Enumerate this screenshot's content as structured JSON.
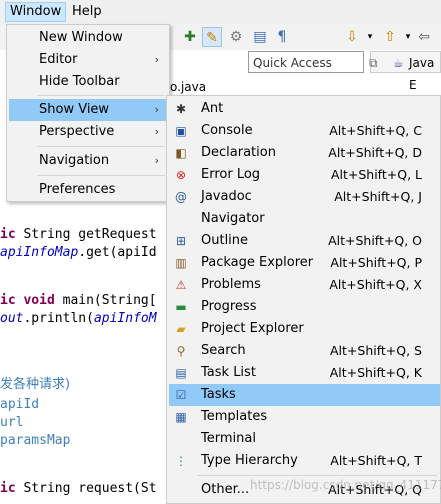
{
  "menubar": {
    "window": "Window",
    "help": "Help"
  },
  "quick_access": {
    "placeholder": "Quick Access",
    "perspective": "Java E"
  },
  "editor_tab": "o.java",
  "window_menu": {
    "items": [
      {
        "label": "New Window"
      },
      {
        "label": "Editor",
        "arrow": "›"
      },
      {
        "label": "Hide Toolbar"
      },
      {
        "label": "Show View",
        "arrow": "›"
      },
      {
        "label": "Perspective",
        "arrow": "›"
      },
      {
        "label": "Navigation",
        "arrow": "›"
      },
      {
        "label": "Preferences"
      }
    ]
  },
  "show_view": {
    "items": [
      {
        "label": "Ant",
        "shortcut": "",
        "icon": "ant-icon"
      },
      {
        "label": "Console",
        "shortcut": "Alt+Shift+Q, C",
        "icon": "console-icon"
      },
      {
        "label": "Declaration",
        "shortcut": "Alt+Shift+Q, D",
        "icon": "declaration-icon"
      },
      {
        "label": "Error Log",
        "shortcut": "Alt+Shift+Q, L",
        "icon": "error-log-icon"
      },
      {
        "label": "Javadoc",
        "shortcut": "Alt+Shift+Q, J",
        "icon": "javadoc-icon"
      },
      {
        "label": "Navigator",
        "shortcut": "",
        "icon": "navigator-icon"
      },
      {
        "label": "Outline",
        "shortcut": "Alt+Shift+Q, O",
        "icon": "outline-icon"
      },
      {
        "label": "Package Explorer",
        "shortcut": "Alt+Shift+Q, P",
        "icon": "package-explorer-icon"
      },
      {
        "label": "Problems",
        "shortcut": "Alt+Shift+Q, X",
        "icon": "problems-icon"
      },
      {
        "label": "Progress",
        "shortcut": "",
        "icon": "progress-icon"
      },
      {
        "label": "Project Explorer",
        "shortcut": "",
        "icon": "project-explorer-icon"
      },
      {
        "label": "Search",
        "shortcut": "Alt+Shift+Q, S",
        "icon": "search-icon"
      },
      {
        "label": "Task List",
        "shortcut": "Alt+Shift+Q, K",
        "icon": "task-list-icon"
      },
      {
        "label": "Tasks",
        "shortcut": "",
        "icon": "tasks-icon"
      },
      {
        "label": "Templates",
        "shortcut": "",
        "icon": "templates-icon"
      },
      {
        "label": "Terminal",
        "shortcut": "",
        "icon": "terminal-icon"
      },
      {
        "label": "Type Hierarchy",
        "shortcut": "Alt+Shift+Q, T",
        "icon": "type-hierarchy-icon"
      },
      {
        "label": "Other...",
        "shortcut": "Alt+Shift+Q, Q",
        "icon": "other-icon"
      }
    ]
  },
  "code": {
    "l1a": "ic String getRequest",
    "l2a": "apiInfoMap",
    "l2b": ".get(apiId",
    "l3a": "ic void main(String[",
    "l4a": "out",
    "l4b": ".println(",
    "l4c": "apiInfoM",
    "l5": "发各种请求)",
    "l6": "apiId",
    "l7": "url",
    "l8": "paramsMap",
    "l9": "ic String request(St"
  },
  "watermark": "https://blog.csdn.net/qq_4111777",
  "colors": {
    "selection": "#91c9f7",
    "keyword": "#7f0055",
    "field": "#0000c0",
    "comment": "#3f7fbf"
  }
}
